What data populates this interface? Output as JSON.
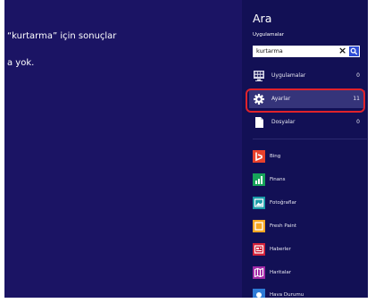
{
  "results": {
    "title": "“kurtarma” için sonuçlar",
    "message": "a yok."
  },
  "charm": {
    "title": "Ara",
    "scope_label": "Uygulamalar",
    "search": {
      "value": "kurtarma"
    },
    "categories": [
      {
        "label": "Uygulamalar",
        "count": "0",
        "icon": "apps-icon",
        "selected": false
      },
      {
        "label": "Ayarlar",
        "count": "11",
        "icon": "settings-gear-icon",
        "selected": true
      },
      {
        "label": "Dosyalar",
        "count": "0",
        "icon": "file-icon",
        "selected": false
      }
    ],
    "apps": [
      {
        "label": "Bing",
        "color": "#e8412c"
      },
      {
        "label": "Finans",
        "color": "#17a35a"
      },
      {
        "label": "Fotoğraflar",
        "color": "#1b9ba8"
      },
      {
        "label": "Fresh Paint",
        "color": "#f5a623"
      },
      {
        "label": "Haberler",
        "color": "#d1213a"
      },
      {
        "label": "Haritalar",
        "color": "#a22aa8"
      },
      {
        "label": "Hava Durumu",
        "color": "#2d7ad6"
      }
    ]
  },
  "colors": {
    "background": "#1b1464",
    "charm_background": "#121055",
    "selection": "#35347a",
    "highlight_outline": "#e0222b",
    "search_button": "#2e4cd6"
  }
}
